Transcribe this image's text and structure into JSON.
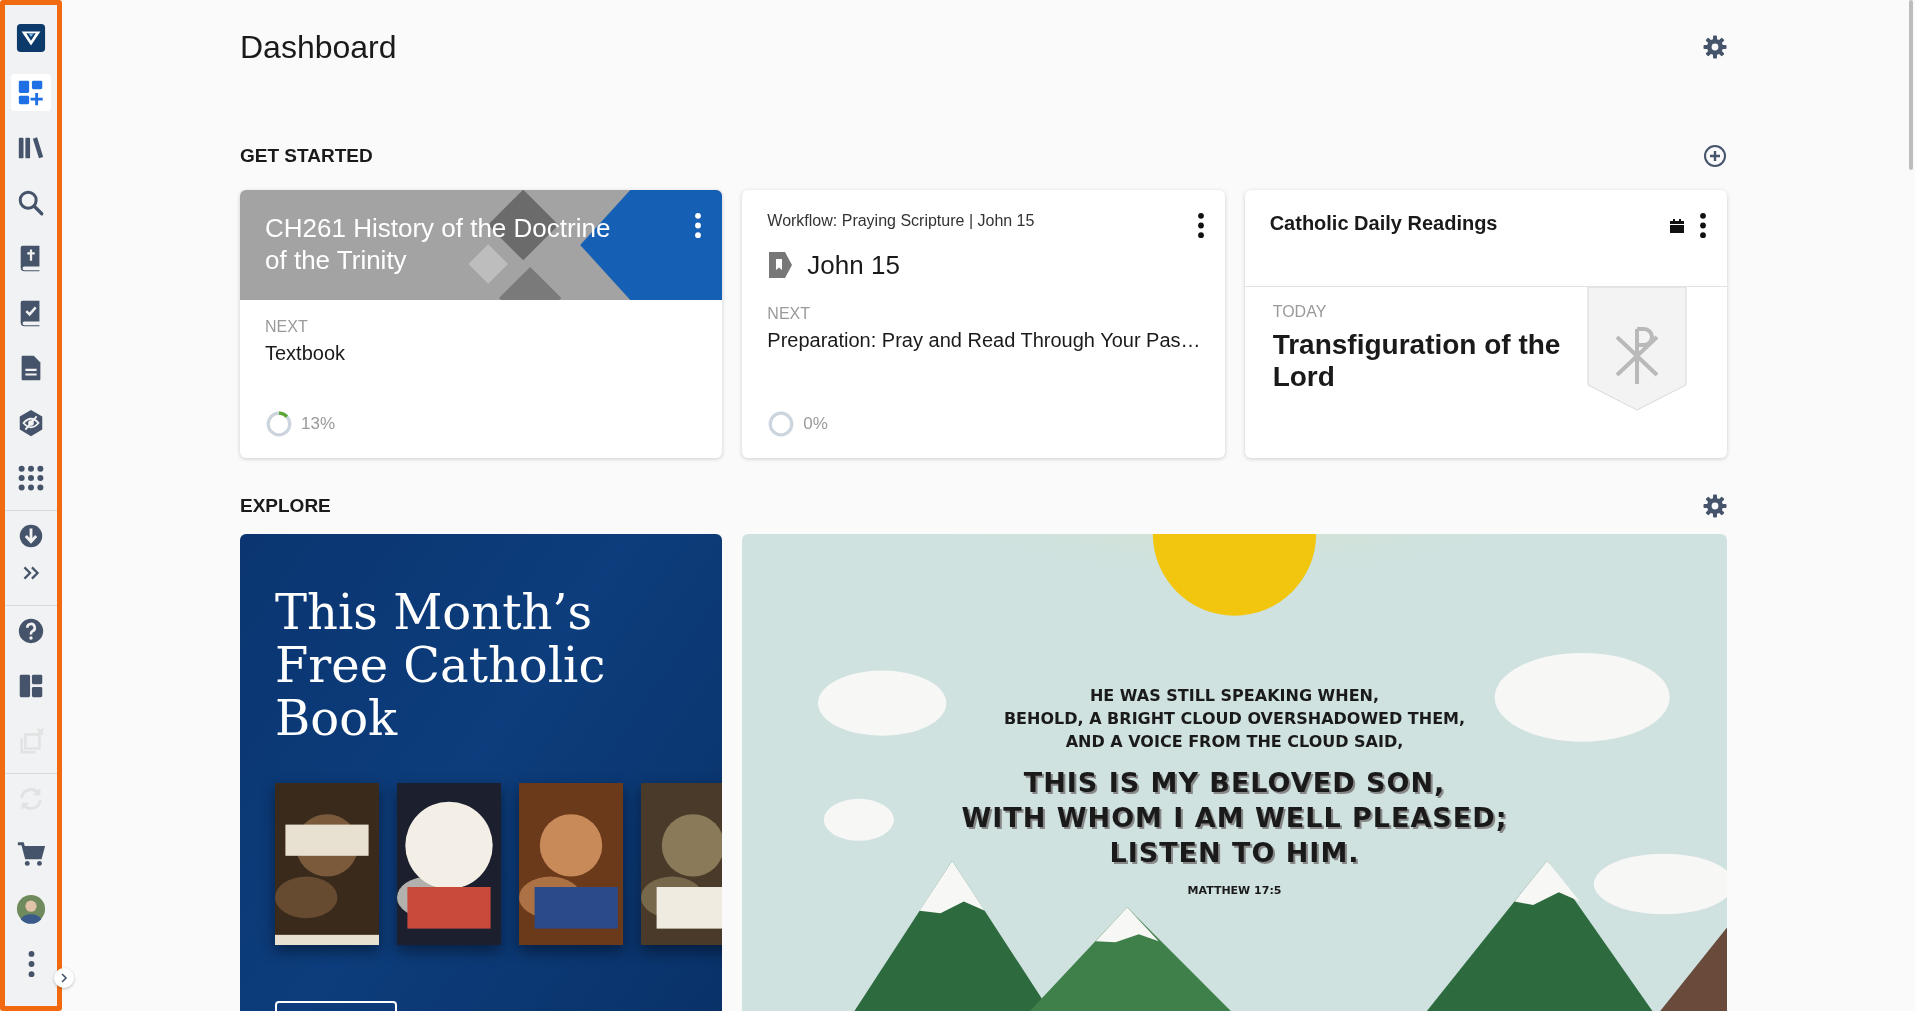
{
  "sidebar": {
    "groups": [
      [
        {
          "kind": "logo",
          "selected": false,
          "disabled": false
        },
        {
          "kind": "dashboard",
          "selected": true,
          "disabled": false
        },
        {
          "kind": "library",
          "selected": false,
          "disabled": false
        },
        {
          "kind": "search",
          "selected": false,
          "disabled": false
        },
        {
          "kind": "bible",
          "selected": false,
          "disabled": false
        },
        {
          "kind": "checklist",
          "selected": false,
          "disabled": false
        },
        {
          "kind": "document",
          "selected": false,
          "disabled": false
        },
        {
          "kind": "eye-shield",
          "selected": false,
          "disabled": false
        },
        {
          "kind": "apps",
          "selected": false,
          "disabled": false
        }
      ],
      [
        {
          "kind": "download",
          "selected": false,
          "disabled": false
        },
        {
          "kind": "expand",
          "selected": false,
          "disabled": false
        }
      ],
      [
        {
          "kind": "help",
          "selected": false,
          "disabled": false
        },
        {
          "kind": "layout",
          "selected": false,
          "disabled": false
        },
        {
          "kind": "close-panels",
          "selected": false,
          "disabled": true
        }
      ],
      [
        {
          "kind": "sync",
          "selected": false,
          "disabled": true
        },
        {
          "kind": "cart",
          "selected": false,
          "disabled": false
        },
        {
          "kind": "avatar",
          "selected": false,
          "disabled": false
        },
        {
          "kind": "more",
          "selected": false,
          "disabled": false
        }
      ]
    ]
  },
  "page": {
    "title": "Dashboard"
  },
  "get_started": {
    "title": "GET STARTED",
    "cards": [
      {
        "kind": "course",
        "title": "CH261 History of the Doctrine of the Trinity",
        "next_label": "NEXT",
        "next": "Textbook",
        "progress": {
          "level": 0.13,
          "reading": "13%"
        }
      },
      {
        "kind": "workflow",
        "subtitle": "Workflow: Praying Scripture | John 15",
        "title": "John 15",
        "next_label": "NEXT",
        "next": "Preparation: Pray and Read Through Your Pas…",
        "progress": {
          "level": 0,
          "reading": "0%"
        }
      },
      {
        "kind": "readings",
        "title": "Catholic Daily Readings",
        "label": "TODAY",
        "heading": "Transfiguration of the Lord"
      }
    ]
  },
  "explore": {
    "title": "EXPLORE",
    "cards": [
      {
        "kind": "promo",
        "title": "This Month’s Free Catholic Book"
      },
      {
        "kind": "verse",
        "intro": "HE WAS STILL SPEAKING WHEN,\nBEHOLD, A BRIGHT CLOUD OVERSHADOWED THEM,\nAND A VOICE FROM THE CLOUD SAID,",
        "quote": "THIS IS MY BELOVED SON,\nWITH WHOM I AM WELL PLEASED;\nLISTEN TO HIM.",
        "reference": "MATTHEW 17:5"
      }
    ]
  }
}
